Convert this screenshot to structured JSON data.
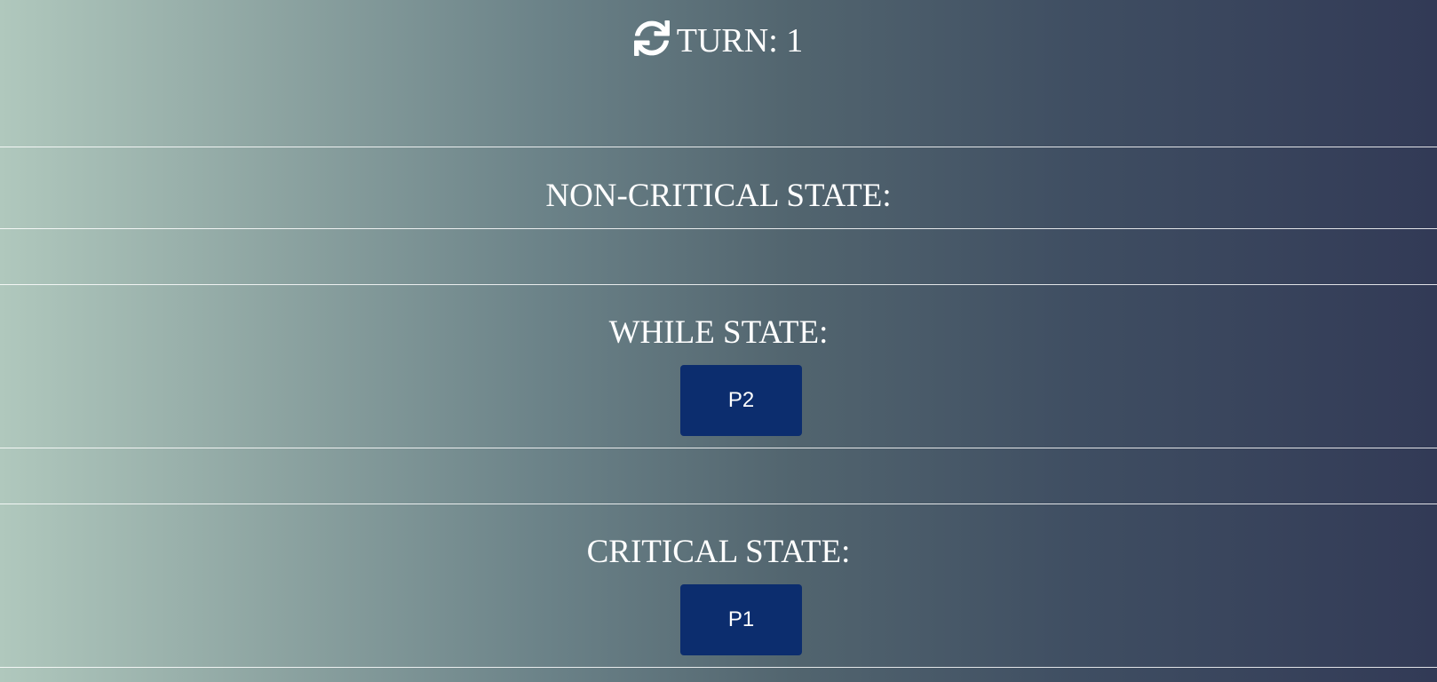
{
  "header": {
    "icon": "refresh-icon",
    "turn_label": "TURN: 1"
  },
  "sections": {
    "non_critical": {
      "title": "NON-CRITICAL STATE:",
      "processes": []
    },
    "while": {
      "title": "WHILE STATE:",
      "processes": [
        "P2"
      ]
    },
    "critical": {
      "title": "CRITICAL STATE:",
      "processes": [
        "P1"
      ]
    }
  },
  "colors": {
    "gradient_start": "#b0c8bd",
    "gradient_end": "#323a56",
    "process_button": "#0c2d6e",
    "text": "#ffffff"
  }
}
